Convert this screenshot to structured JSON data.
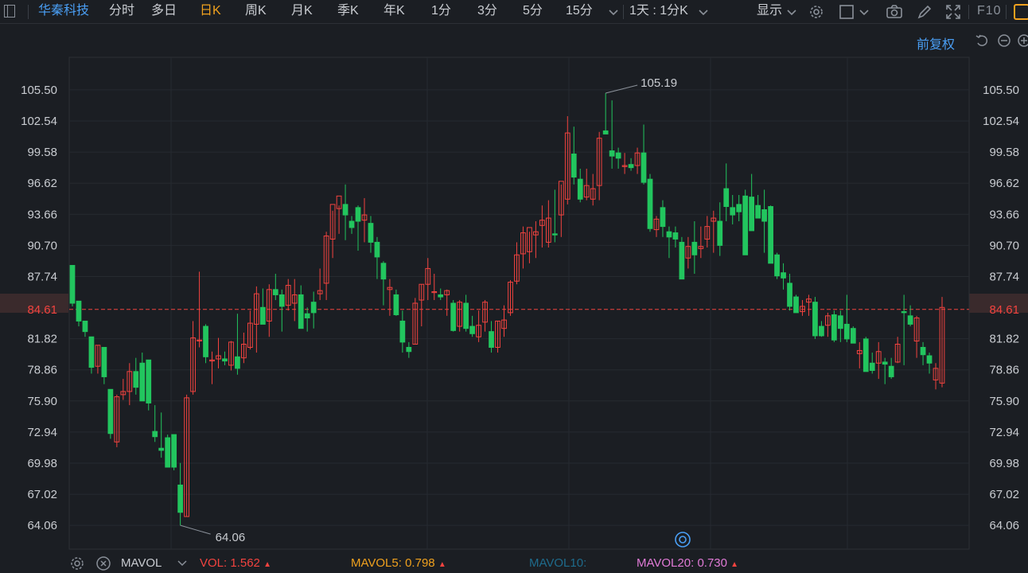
{
  "toolbar": {
    "stock_name": "华秦科技",
    "periods": [
      "分时",
      "多日",
      "日K",
      "周K",
      "月K",
      "季K",
      "年K",
      "1分",
      "3分",
      "5分",
      "15分"
    ],
    "active_period": "日K",
    "multi_period": "1天 : 1分K",
    "display": "显示",
    "f10": "F10"
  },
  "adjust_label": "前复权",
  "colors": {
    "up": "#f2433f",
    "down": "#22c55e",
    "active": "#f0a11e",
    "blue": "#4a9ff5",
    "mavol5": "#f0a11e",
    "mavol10": "#1e6b8c",
    "mavol20": "#e07ad6"
  },
  "chart_data": {
    "type": "candlestick",
    "y_ticks": [
      "105.50",
      "102.54",
      "99.58",
      "96.62",
      "93.66",
      "90.70",
      "87.74",
      "84.61",
      "81.82",
      "78.86",
      "75.90",
      "72.94",
      "69.98",
      "67.02",
      "64.06"
    ],
    "ylim": [
      61.8,
      108.6
    ],
    "current_price": "84.61",
    "high_label": "105.19",
    "low_label": "64.06",
    "grid": true,
    "ohlc": [
      [
        88.8,
        88.8,
        84.9,
        85.2
      ],
      [
        85.4,
        85.4,
        83.0,
        83.5
      ],
      [
        83.5,
        83.5,
        82.0,
        82.5
      ],
      [
        82.0,
        82.0,
        78.5,
        79.1
      ],
      [
        79.2,
        81.2,
        78.5,
        81.2
      ],
      [
        81.0,
        81.0,
        77.5,
        78.2
      ],
      [
        77.0,
        77.0,
        72.3,
        72.8
      ],
      [
        72.0,
        76.5,
        71.5,
        76.3
      ],
      [
        76.5,
        78.0,
        76.0,
        76.8
      ],
      [
        76.8,
        79.5,
        75.5,
        78.7
      ],
      [
        78.7,
        80.0,
        76.5,
        77.2
      ],
      [
        79.5,
        80.5,
        76.5,
        75.9
      ],
      [
        79.8,
        79.8,
        75.0,
        75.7
      ],
      [
        73.0,
        75.5,
        72.0,
        72.5
      ],
      [
        71.4,
        74.8,
        70.5,
        71.2
      ],
      [
        72.4,
        72.7,
        69.6,
        69.6
      ],
      [
        72.7,
        72.7,
        69.3,
        69.6
      ],
      [
        67.9,
        70.0,
        64.06,
        65.3
      ],
      [
        64.9,
        76.5,
        64.9,
        76.2
      ],
      [
        76.8,
        83.5,
        76.5,
        81.9
      ],
      [
        81.7,
        88.2,
        81.0,
        81.7
      ],
      [
        83.0,
        83.2,
        79.5,
        80.1
      ],
      [
        79.7,
        80.6,
        77.5,
        79.8
      ],
      [
        79.9,
        81.9,
        79.0,
        80.2
      ],
      [
        79.9,
        80.6,
        79.3,
        79.7
      ],
      [
        79.3,
        81.6,
        78.8,
        81.5
      ],
      [
        80.1,
        84.2,
        78.4,
        79.0
      ],
      [
        80.0,
        82.4,
        79.5,
        81.3
      ],
      [
        81.0,
        84.5,
        80.8,
        83.3
      ],
      [
        83.2,
        86.8,
        80.5,
        86.1
      ],
      [
        84.8,
        86.6,
        84.6,
        83.2
      ],
      [
        83.5,
        87.0,
        82.0,
        86.5
      ],
      [
        86.5,
        88.0,
        85.5,
        86.0
      ],
      [
        86.0,
        86.5,
        82.5,
        84.9
      ],
      [
        85.0,
        87.5,
        84.5,
        86.9
      ],
      [
        85.2,
        87.5,
        83.5,
        86.0
      ],
      [
        86.0,
        86.9,
        82.9,
        82.8
      ],
      [
        84.2,
        84.8,
        82.5,
        83.8
      ],
      [
        85.3,
        86.3,
        82.8,
        84.3
      ],
      [
        86.1,
        88.5,
        85.5,
        86.4
      ],
      [
        87.1,
        92.0,
        85.5,
        91.6
      ],
      [
        91.3,
        94.0,
        89.5,
        94.6
      ],
      [
        94.2,
        94.5,
        91.8,
        95.4
      ],
      [
        94.6,
        96.5,
        91.2,
        93.6
      ],
      [
        93.0,
        93.5,
        91.8,
        92.4
      ],
      [
        94.3,
        94.5,
        90.2,
        93.0
      ],
      [
        93.1,
        95.2,
        91.0,
        93.6
      ],
      [
        92.8,
        93.5,
        90.0,
        91.0
      ],
      [
        91.0,
        91.5,
        87.5,
        89.6
      ],
      [
        89.0,
        89.2,
        85.0,
        87.5
      ],
      [
        86.5,
        87.5,
        84.0,
        86.7
      ],
      [
        86.0,
        86.5,
        84.0,
        84.1
      ],
      [
        83.5,
        84.5,
        80.5,
        81.5
      ],
      [
        81.0,
        81.5,
        80.0,
        80.6
      ],
      [
        81.3,
        85.7,
        81.3,
        85.2
      ],
      [
        85.5,
        87.0,
        83.0,
        87.0
      ],
      [
        87.0,
        89.5,
        85.5,
        88.5
      ],
      [
        86.3,
        88.0,
        85.5,
        86.3
      ],
      [
        86.0,
        86.6,
        85.5,
        85.8
      ],
      [
        86.0,
        86.5,
        84.0,
        86.4
      ],
      [
        85.2,
        85.5,
        82.5,
        82.6
      ],
      [
        83.0,
        85.5,
        82.5,
        85.3
      ],
      [
        85.2,
        86.0,
        82.5,
        82.8
      ],
      [
        83.0,
        84.0,
        82.0,
        82.3
      ],
      [
        82.0,
        84.5,
        81.5,
        83.1
      ],
      [
        83.4,
        85.5,
        82.5,
        85.3
      ],
      [
        82.5,
        83.5,
        80.5,
        81.0
      ],
      [
        81.0,
        83.5,
        80.5,
        83.5
      ],
      [
        82.8,
        85.0,
        82.0,
        83.6
      ],
      [
        84.3,
        87.4,
        84.0,
        87.2
      ],
      [
        87.3,
        91.0,
        87.0,
        89.8
      ],
      [
        89.9,
        92.5,
        88.5,
        91.9
      ],
      [
        90.1,
        92.0,
        89.0,
        92.4
      ],
      [
        91.7,
        93.0,
        89.5,
        92.0
      ],
      [
        92.6,
        94.5,
        90.5,
        93.1
      ],
      [
        91.0,
        95.0,
        90.5,
        93.3
      ],
      [
        91.8,
        96.0,
        91.0,
        91.7
      ],
      [
        93.6,
        96.5,
        91.5,
        96.8
      ],
      [
        95.1,
        103.0,
        94.6,
        101.4
      ],
      [
        99.4,
        102.0,
        96.5,
        97.2
      ],
      [
        97.0,
        98.0,
        94.8,
        95.1
      ],
      [
        95.3,
        98.0,
        95.0,
        96.4
      ],
      [
        95.1,
        97.5,
        94.5,
        96.1
      ],
      [
        96.4,
        101.5,
        95.0,
        100.9
      ],
      [
        101.6,
        105.19,
        101.5,
        101.3
      ],
      [
        99.7,
        104.5,
        98.0,
        99.2
      ],
      [
        99.5,
        100.0,
        98.0,
        99.0
      ],
      [
        98.2,
        99.5,
        97.5,
        98.3
      ],
      [
        98.4,
        99.0,
        97.8,
        98.1
      ],
      [
        98.3,
        100.0,
        97.5,
        99.5
      ],
      [
        99.5,
        102.2,
        96.5,
        96.7
      ],
      [
        97.0,
        97.5,
        92.0,
        92.3
      ],
      [
        92.2,
        93.5,
        91.5,
        93.2
      ],
      [
        94.3,
        95.0,
        91.5,
        92.5
      ],
      [
        92.0,
        92.5,
        89.5,
        91.5
      ],
      [
        91.9,
        92.5,
        90.5,
        91.3
      ],
      [
        91.0,
        91.5,
        87.8,
        87.5
      ],
      [
        89.5,
        91.5,
        88.5,
        90.6
      ],
      [
        91.0,
        93.0,
        88.0,
        89.8
      ],
      [
        90.4,
        92.5,
        89.5,
        90.6
      ],
      [
        91.3,
        93.5,
        90.5,
        92.5
      ],
      [
        93.0,
        94.0,
        90.0,
        93.3
      ],
      [
        93.0,
        94.8,
        89.7,
        90.7
      ],
      [
        96.1,
        98.5,
        93.0,
        94.4
      ],
      [
        94.3,
        95.5,
        92.7,
        93.6
      ],
      [
        94.6,
        95.5,
        93.0,
        93.9
      ],
      [
        95.4,
        96.0,
        90.5,
        89.8
      ],
      [
        95.3,
        97.5,
        93.5,
        92.1
      ],
      [
        94.5,
        95.5,
        93.5,
        93.3
      ],
      [
        94.1,
        96.0,
        90.0,
        93.0
      ],
      [
        94.4,
        94.5,
        89.5,
        89.0
      ],
      [
        89.8,
        90.0,
        87.5,
        87.8
      ],
      [
        88.1,
        89.0,
        86.5,
        87.6
      ],
      [
        87.1,
        88.0,
        84.5,
        84.9
      ],
      [
        85.8,
        86.0,
        84.3,
        84.3
      ],
      [
        84.4,
        85.5,
        84.0,
        84.9
      ],
      [
        85.3,
        86.0,
        84.0,
        85.6
      ],
      [
        85.3,
        85.8,
        81.8,
        82.1
      ],
      [
        83.0,
        83.5,
        82.0,
        82.1
      ],
      [
        83.1,
        84.3,
        82.0,
        84.0
      ],
      [
        84.1,
        84.5,
        81.5,
        81.7
      ],
      [
        84.0,
        84.5,
        81.5,
        82.8
      ],
      [
        83.2,
        86.0,
        81.5,
        81.8
      ],
      [
        82.8,
        83.0,
        81.5,
        81.4
      ],
      [
        80.4,
        81.5,
        79.0,
        80.7
      ],
      [
        81.8,
        82.0,
        79.5,
        78.7
      ],
      [
        79.5,
        80.5,
        78.5,
        78.8
      ],
      [
        79.5,
        81.5,
        78.0,
        80.6
      ],
      [
        79.6,
        80.0,
        77.5,
        79.4
      ],
      [
        79.2,
        80.0,
        78.0,
        78.2
      ],
      [
        79.6,
        82.0,
        79.5,
        81.3
      ],
      [
        84.4,
        86.0,
        79.3,
        84.3
      ],
      [
        84.0,
        85.0,
        83.0,
        83.2
      ],
      [
        81.6,
        84.0,
        80.0,
        83.8
      ],
      [
        81.0,
        81.5,
        79.3,
        80.3
      ],
      [
        80.2,
        80.5,
        78.5,
        79.5
      ],
      [
        77.9,
        79.5,
        77.0,
        79.0
      ],
      [
        77.6,
        85.8,
        77.2,
        84.8
      ]
    ]
  },
  "footer": {
    "indicator": "MAVOL",
    "vol_label": "VOL:",
    "vol_value": "1.562",
    "mavol5_label": "MAVOL5:",
    "mavol5_value": "0.798",
    "mavol10_label": "MAVOL10:",
    "mavol20_label": "MAVOL20:",
    "mavol20_value": "0.730"
  }
}
